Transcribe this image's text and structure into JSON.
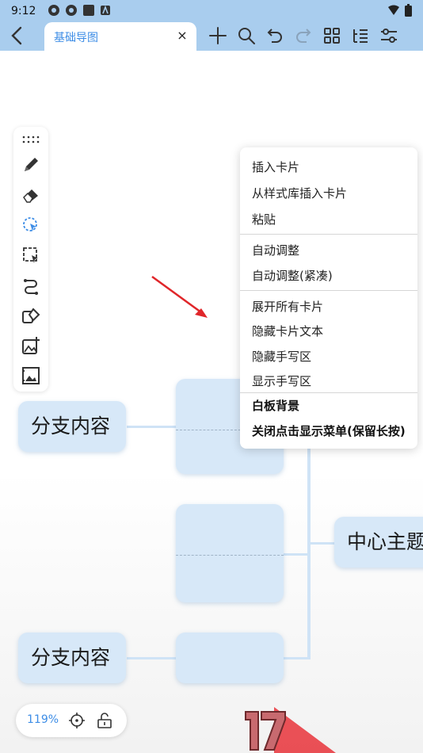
{
  "status_bar": {
    "time": "9:12"
  },
  "tab": {
    "title": "基础导图",
    "close": "×"
  },
  "toolbar_icons": [
    "back-icon",
    "add-icon",
    "search-icon",
    "undo-icon",
    "redo-icon",
    "grid-icon",
    "outline-icon",
    "settings-sliders-icon"
  ],
  "palette_icons": [
    "drag-handle-icon",
    "pen-icon",
    "eraser-icon",
    "lasso-select-icon",
    "box-select-icon",
    "connector-icon",
    "shape-icon",
    "insert-image-icon",
    "image-frame-icon"
  ],
  "nodes": {
    "branch_top": "分支内容",
    "branch_bottom": "分支内容",
    "center": "中心主题"
  },
  "menu": {
    "insert_card": "插入卡片",
    "insert_from_style": "从样式库插入卡片",
    "paste": "粘贴",
    "auto_adjust": "自动调整",
    "auto_adjust_compact": "自动调整(紧凑)",
    "expand_all": "展开所有卡片",
    "hide_card_text": "隐藏卡片文本",
    "hide_handwriting": "隐藏手写区",
    "show_handwriting": "显示手写区",
    "whiteboard_bg": "白板背景",
    "close_tap_menu": "关闭点击显示菜单(保留长按)"
  },
  "zoom": {
    "level": "119%"
  },
  "colors": {
    "accent": "#3d8de6",
    "topbar": "#a9cdee",
    "node": "#d7e8f8",
    "arrow": "#e0262a"
  }
}
